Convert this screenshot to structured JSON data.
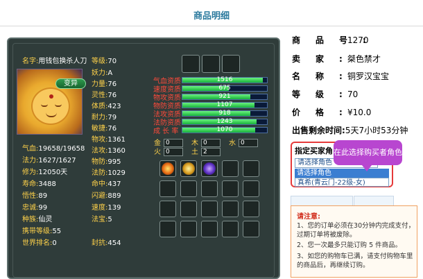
{
  "header": {
    "title": "商品明细"
  },
  "character": {
    "name_label": "名字:",
    "name": "用钱包换杀人刀",
    "badge": "变异",
    "left_stats": [
      {
        "label": "气血:",
        "value": "19658/19658"
      },
      {
        "label": "法力:",
        "value": "1627/1627"
      },
      {
        "label": "修为:",
        "value": "12050天"
      },
      {
        "label": "寿命:",
        "value": "3488"
      },
      {
        "label": "悟性:",
        "value": "89"
      },
      {
        "label": "忠诚:",
        "value": "99"
      },
      {
        "label": "种族:",
        "value": "仙灵"
      },
      {
        "label": "携带等级:",
        "value": "55"
      },
      {
        "label": "世界排名:",
        "value": "0"
      }
    ],
    "mid_top_stats": [
      {
        "label": "等级:",
        "value": "70"
      },
      {
        "label": "妖力:",
        "value": "A"
      },
      {
        "label": "力量:",
        "value": "76"
      },
      {
        "label": "灵性:",
        "value": "76"
      },
      {
        "label": "体质:",
        "value": "423"
      },
      {
        "label": "耐力:",
        "value": "79"
      },
      {
        "label": "敏捷:",
        "value": "76"
      }
    ],
    "mid_bottom_stats": [
      {
        "label": "物攻:",
        "value": "1361"
      },
      {
        "label": "法攻:",
        "value": "1360"
      },
      {
        "label": "物防:",
        "value": "995"
      },
      {
        "label": "法防:",
        "value": "1029"
      },
      {
        "label": "命中:",
        "value": "437"
      },
      {
        "label": "闪避:",
        "value": "889"
      },
      {
        "label": "速度:",
        "value": "139"
      },
      {
        "label": "法宝:",
        "value": "5"
      },
      {
        "label": "封抗:",
        "value": "454"
      }
    ],
    "aptitudes": [
      {
        "label": "气血资质",
        "value": "1516",
        "fraction": 0.95
      },
      {
        "label": "速度资质",
        "value": "675",
        "fraction": 0.55
      },
      {
        "label": "物攻资质",
        "value": "921",
        "fraction": 0.8
      },
      {
        "label": "物防资质",
        "value": "1107",
        "fraction": 0.85
      },
      {
        "label": "法攻资质",
        "value": "918",
        "fraction": 0.8
      },
      {
        "label": "法防资质",
        "value": "1243",
        "fraction": 0.88
      },
      {
        "label": "成 长 率",
        "value": "1070",
        "fraction": 0.86
      }
    ],
    "elements": [
      {
        "label": "金",
        "value": "0"
      },
      {
        "label": "木",
        "value": "0"
      },
      {
        "label": "水",
        "value": "0"
      },
      {
        "label": "火",
        "value": "0"
      },
      {
        "label": "土",
        "value": "2"
      }
    ]
  },
  "product": {
    "rows": [
      {
        "key": "商品号:",
        "value": "1270"
      },
      {
        "key": "卖家:",
        "value": "桀色禁才"
      },
      {
        "key": "名称:",
        "value": "铜罗汉宝宝"
      },
      {
        "key": "等级:",
        "value": "70"
      },
      {
        "key": "价格:",
        "value": "¥10.0"
      }
    ],
    "sale_label": "出售剩余时间:",
    "sale_value": "5天7小时53分钟"
  },
  "buyer": {
    "title": "指定买家角",
    "select_value": "请选择角色",
    "options": [
      "请选择角色",
      "真希(青云门-22级-女)"
    ],
    "tooltip": "在此选择购买者角色"
  },
  "notice": {
    "title": "请注意:",
    "items": [
      "1、您的订单必须在30分钟内完成支付，过期订单将被废除。",
      "2、您一次最多只能订购 5 件商品。",
      "3、如您的购物车已满，请支付购物车里的商品后，再继续订购。"
    ]
  }
}
